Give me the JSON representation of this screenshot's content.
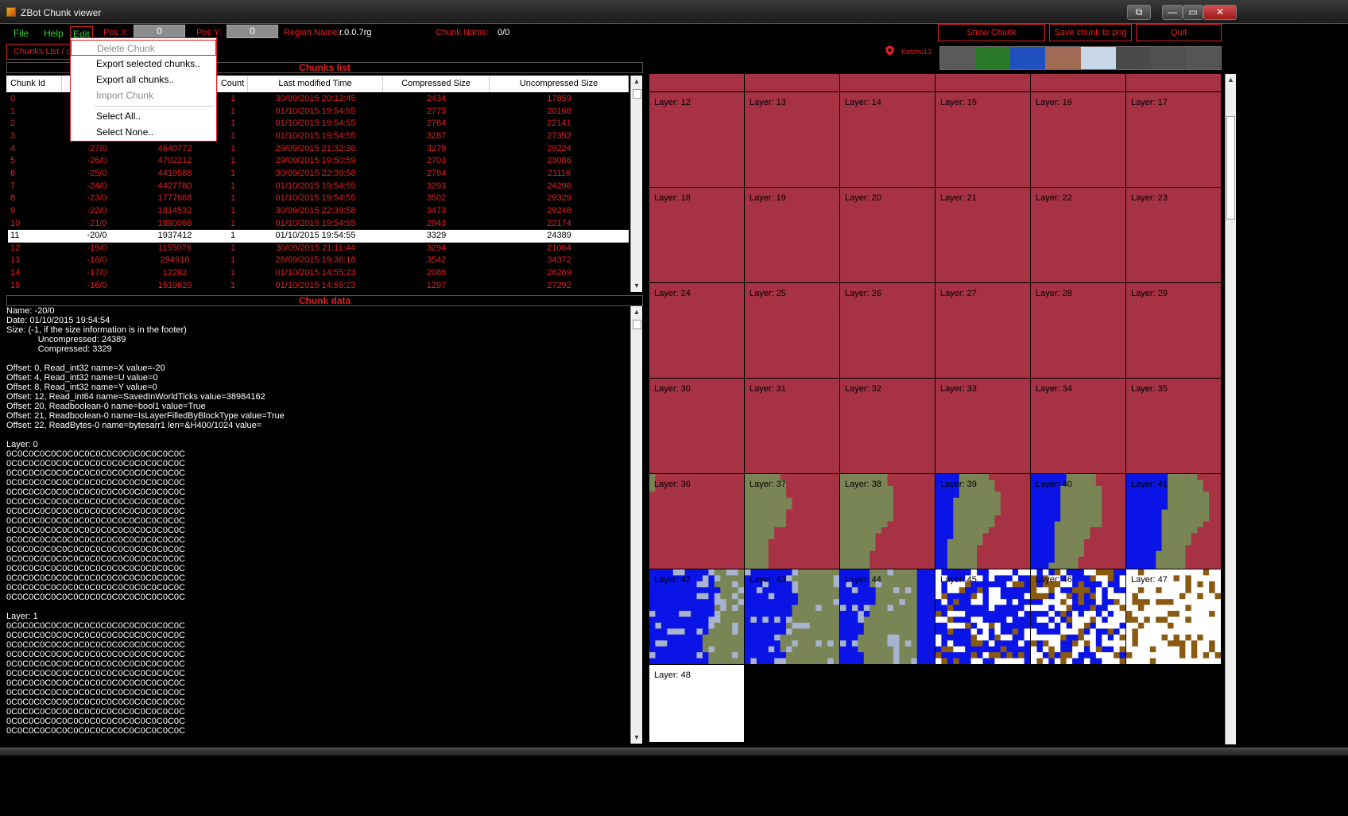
{
  "window": {
    "title": "ZBot Chunk viewer",
    "minimize": "—",
    "maximize": "▭",
    "close": "✕",
    "restore": "⧉"
  },
  "menu": {
    "file": "File",
    "help": "Help",
    "edit": "Edit"
  },
  "pos": {
    "x_label": "Pos X:",
    "x_value": "0",
    "y_label": "Pos Y:",
    "y_value": "0"
  },
  "region": {
    "label": "Region Name:",
    "value": "r.0.0.7rg"
  },
  "chunk_name": {
    "label": "Chunk Name:",
    "value": "0/0"
  },
  "buttons": {
    "show_chunk": "Show Chunk",
    "save_png": "Save chunk to png",
    "quit": "Quit",
    "chunks_list_tab": "Chunks List / d"
  },
  "user": {
    "name": "Ketchu13"
  },
  "sections": {
    "chunks_list": "Chunks list",
    "chunk_data": "Chunk data"
  },
  "table": {
    "headers": [
      "Chunk Id",
      "",
      "",
      "Count",
      "Last modified Time",
      "Compressed Size",
      "Uncompressed Size"
    ],
    "rows": [
      {
        "id": "0",
        "name": "",
        "offset": "",
        "count": "1",
        "time": "30/09/2015 20:12:45",
        "csize": "2434",
        "usize": "17859"
      },
      {
        "id": "1",
        "name": "",
        "offset": "",
        "count": "1",
        "time": "01/10/2015 19:54:55",
        "csize": "2773",
        "usize": "20168"
      },
      {
        "id": "2",
        "name": "",
        "offset": "",
        "count": "1",
        "time": "01/10/2015 19:54:55",
        "csize": "2764",
        "usize": "22141"
      },
      {
        "id": "3",
        "name": "",
        "offset": "",
        "count": "1",
        "time": "01/10/2015 19:54:55",
        "csize": "3287",
        "usize": "27352"
      },
      {
        "id": "4",
        "name": "-27/0",
        "offset": "4640772",
        "count": "1",
        "time": "29/09/2015 21:32:36",
        "csize": "3279",
        "usize": "29224"
      },
      {
        "id": "5",
        "name": "-26/0",
        "offset": "4702212",
        "count": "1",
        "time": "29/09/2015 19:50:59",
        "csize": "2703",
        "usize": "23086"
      },
      {
        "id": "6",
        "name": "-25/0",
        "offset": "4419588",
        "count": "1",
        "time": "30/09/2015 22:39:58",
        "csize": "2794",
        "usize": "21116"
      },
      {
        "id": "7",
        "name": "-24/0",
        "offset": "4427780",
        "count": "1",
        "time": "01/10/2015 19:54:55",
        "csize": "3293",
        "usize": "24298"
      },
      {
        "id": "8",
        "name": "-23/0",
        "offset": "1777668",
        "count": "1",
        "time": "01/10/2015 19:54:55",
        "csize": "3502",
        "usize": "29329"
      },
      {
        "id": "9",
        "name": "-22/0",
        "offset": "1814532",
        "count": "1",
        "time": "30/09/2015 22:39:58",
        "csize": "3473",
        "usize": "29248"
      },
      {
        "id": "10",
        "name": "-21/0",
        "offset": "1880068",
        "count": "1",
        "time": "01/10/2015 19:54:55",
        "csize": "2943",
        "usize": "22174"
      },
      {
        "id": "11",
        "name": "-20/0",
        "offset": "1937412",
        "count": "1",
        "time": "01/10/2015 19:54:55",
        "csize": "3329",
        "usize": "24389"
      },
      {
        "id": "12",
        "name": "-19/0",
        "offset": "1155076",
        "count": "1",
        "time": "30/09/2015 21:11:44",
        "csize": "3294",
        "usize": "21064"
      },
      {
        "id": "13",
        "name": "-18/0",
        "offset": "294916",
        "count": "1",
        "time": "28/09/2015 19:36:18",
        "csize": "3542",
        "usize": "34372"
      },
      {
        "id": "14",
        "name": "-17/0",
        "offset": "12292",
        "count": "1",
        "time": "01/10/2015 14:55:23",
        "csize": "2086",
        "usize": "26269"
      },
      {
        "id": "15",
        "name": "-16/0",
        "offset": "1519620",
        "count": "1",
        "time": "01/10/2015 14:55:23",
        "csize": "1297",
        "usize": "27292"
      }
    ]
  },
  "dropdown": {
    "items": [
      {
        "label": "Delete Chunk",
        "disabled": true
      },
      {
        "label": "Export selected chunks..",
        "disabled": false
      },
      {
        "label": "Export all chunks..",
        "disabled": false
      },
      {
        "label": "Import Chunk",
        "disabled": true
      },
      {
        "label": "Select All..",
        "disabled": false
      },
      {
        "label": "Select None..",
        "disabled": false
      }
    ]
  },
  "chunk_data_text": "Name: -20/0\nDate: 01/10/2015 19:54:54\nSize: (-1, if the size information is in the footer)\n             Uncompressed: 24389\n             Compressed: 3329\n\nOffset: 0, Read_int32 name=X value=-20\nOffset: 4, Read_int32 name=U value=0\nOffset: 8, Read_int32 name=Y value=0\nOffset: 12, Read_int64 name=SavedInWorldTicks value=38984162\nOffset: 20, Readboolean-0 name=bool1 value=True\nOffset: 21, Readboolean-0 name=IsLayerFilledByBlockType value=True\nOffset: 22, ReadBytes-0 name=bytesarr1 len=&H400/1024 value=\n\nLayer: 0\n0C0C0C0C0C0C0C0C0C0C0C0C0C0C0C0C\n0C0C0C0C0C0C0C0C0C0C0C0C0C0C0C0C\n0C0C0C0C0C0C0C0C0C0C0C0C0C0C0C0C\n0C0C0C0C0C0C0C0C0C0C0C0C0C0C0C0C\n0C0C0C0C0C0C0C0C0C0C0C0C0C0C0C0C\n0C0C0C0C0C0C0C0C0C0C0C0C0C0C0C0C\n0C0C0C0C0C0C0C0C0C0C0C0C0C0C0C0C\n0C0C0C0C0C0C0C0C0C0C0C0C0C0C0C0C\n0C0C0C0C0C0C0C0C0C0C0C0C0C0C0C0C\n0C0C0C0C0C0C0C0C0C0C0C0C0C0C0C0C\n0C0C0C0C0C0C0C0C0C0C0C0C0C0C0C0C\n0C0C0C0C0C0C0C0C0C0C0C0C0C0C0C0C\n0C0C0C0C0C0C0C0C0C0C0C0C0C0C0C0C\n0C0C0C0C0C0C0C0C0C0C0C0C0C0C0C0C\n0C0C0C0C0C0C0C0C0C0C0C0C0C0C0C0C\n0C0C0C0C0C0C0C0C0C0C0C0C0C0C0C0C\n\nLayer: 1\n0C0C0C0C0C0C0C0C0C0C0C0C0C0C0C0C\n0C0C0C0C0C0C0C0C0C0C0C0C0C0C0C0C\n0C0C0C0C0C0C0C0C0C0C0C0C0C0C0C0C\n0C0C0C0C0C0C0C0C0C0C0C0C0C0C0C0C\n0C0C0C0C0C0C0C0C0C0C0C0C0C0C0C0C\n0C0C0C0C0C0C0C0C0C0C0C0C0C0C0C0C\n0C0C0C0C0C0C0C0C0C0C0C0C0C0C0C0C\n0C0C0C0C0C0C0C0C0C0C0C0C0C0C0C0C\n0C0C0C0C0C0C0C0C0C0C0C0C0C0C0C0C\n0C0C0C0C0C0C0C0C0C0C0C0C0C0C0C0C\n0C0C0C0C0C0C0C0C0C0C0C0C0C0C0C0C\n0C0C0C0C0C0C0C0C0C0C0C0C0C0C0C0C",
  "layers": {
    "labels": [
      "Layer: 12",
      "Layer: 13",
      "Layer: 14",
      "Layer: 15",
      "Layer: 16",
      "Layer: 17",
      "Layer: 18",
      "Layer: 19",
      "Layer: 20",
      "Layer: 21",
      "Layer: 22",
      "Layer: 23",
      "Layer: 24",
      "Layer: 25",
      "Layer: 26",
      "Layer: 27",
      "Layer: 28",
      "Layer: 29",
      "Layer: 30",
      "Layer: 31",
      "Layer: 32",
      "Layer: 33",
      "Layer: 34",
      "Layer: 35",
      "Layer: 36",
      "Layer: 37",
      "Layer: 38",
      "Layer: 39",
      "Layer: 40",
      "Layer: 41",
      "Layer: 42",
      "Layer: 43",
      "Layer: 44",
      "Layer: 45",
      "Layer: 46",
      "Layer: 47",
      "Layer: 48"
    ],
    "colors": {
      "stone": "#a63244",
      "dirt": "#7a8556",
      "water": "#0a14e6",
      "gravel": "#a8b4cf",
      "sand": "#ffffff",
      "wood": "#8a5a10"
    }
  },
  "palette_colors": [
    "#5a5a5a",
    "#2a7a2a",
    "#2050c0",
    "#a06a55",
    "#c8d8e8",
    "#4a4a4a",
    "#505050",
    "#555555"
  ]
}
